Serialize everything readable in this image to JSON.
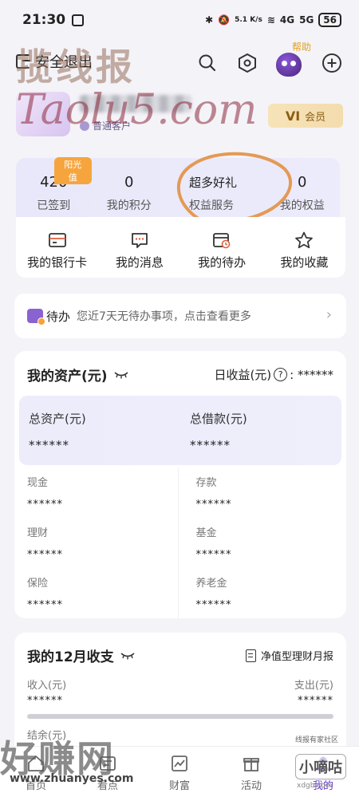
{
  "status_bar": {
    "time": "21:30",
    "network_speed": "5.1 K/s",
    "signal_1": "4G",
    "signal_2": "5G",
    "battery": "56"
  },
  "header": {
    "logout_label": "安全退出",
    "help_label": "帮助"
  },
  "profile": {
    "member_type": "普通客户",
    "vip_level": "VI",
    "vip_label": "会员"
  },
  "stats": [
    {
      "value": "420",
      "label": "已签到",
      "tag": "阳光值"
    },
    {
      "value": "0",
      "label": "我的积分"
    },
    {
      "value": "超多好礼",
      "label": "权益服务"
    },
    {
      "value": "0",
      "label": "我的权益"
    }
  ],
  "quick_entries": [
    {
      "label": "我的银行卡",
      "icon": "bank-card-icon"
    },
    {
      "label": "我的消息",
      "icon": "message-icon"
    },
    {
      "label": "我的待办",
      "icon": "calendar-clock-icon"
    },
    {
      "label": "我的收藏",
      "icon": "star-icon"
    }
  ],
  "todo": {
    "title": "待办",
    "description": "您近7天无待办事项，点击查看更多",
    "arrow": "›"
  },
  "assets": {
    "title": "我的资产(元)",
    "daily_label": "日收益(元)",
    "daily_help": "?",
    "daily_value": ": ******",
    "summary": [
      {
        "label": "总资产(元)",
        "value": "******"
      },
      {
        "label": "总借款(元)",
        "value": "******"
      }
    ],
    "items": [
      {
        "label": "现金",
        "value": "******"
      },
      {
        "label": "存款",
        "value": "******"
      },
      {
        "label": "理财",
        "value": "******"
      },
      {
        "label": "基金",
        "value": "******"
      },
      {
        "label": "保险",
        "value": "******"
      },
      {
        "label": "养老金",
        "value": "******"
      }
    ]
  },
  "monthly": {
    "title": "我的12月收支",
    "report_label": "净值型理财月报",
    "income_label": "收入(元)",
    "expense_label": "支出(元)",
    "income_value": "******",
    "expense_value": "******",
    "balance_label": "结余(元)"
  },
  "bottom_nav": [
    {
      "label": "首页",
      "icon": "home-icon"
    },
    {
      "label": "看点",
      "icon": "news-icon"
    },
    {
      "label": "财富",
      "icon": "chart-icon"
    },
    {
      "label": "活动",
      "icon": "gift-icon"
    },
    {
      "label": "我的",
      "icon": "user-icon",
      "active": true
    }
  ],
  "watermarks": {
    "top_cn": "揽线报",
    "top_en": "Taolu5.com",
    "bottom_cn": "好赚网",
    "bottom_url": "www.zhuanyes.com",
    "corner_brand": "小嘀咕",
    "corner_small": "线报有家社区",
    "corner_url": "xdgb.com"
  },
  "colors": {
    "accent": "#6a3fc8",
    "tag_orange": "#f6a53e",
    "vip_gold": "#8a5e12",
    "card_lavender": "#ebeafa"
  }
}
